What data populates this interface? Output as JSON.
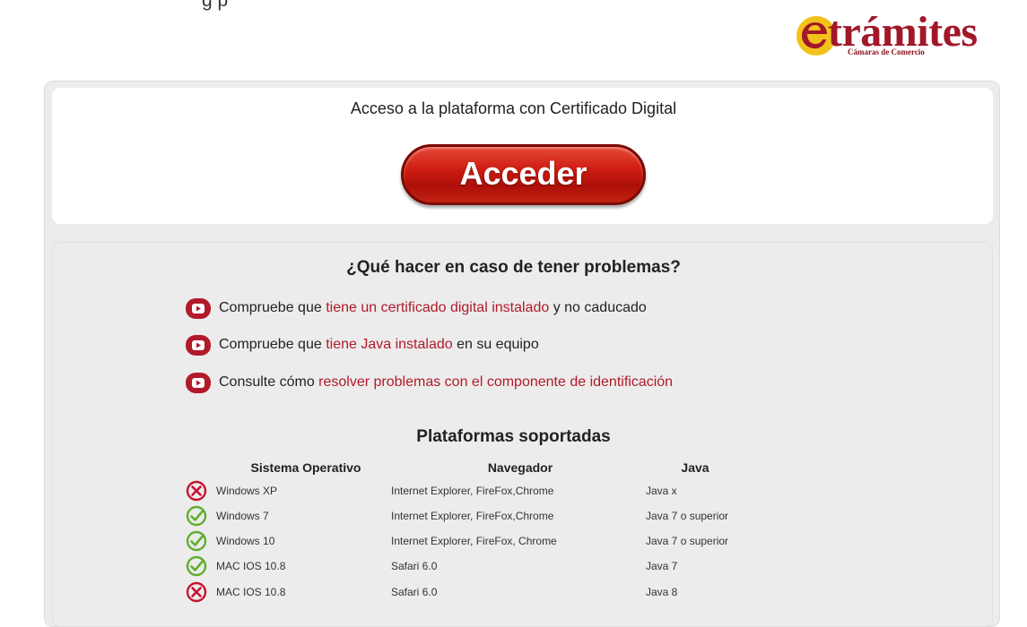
{
  "header": {
    "top_partial_text": "g     p",
    "logo": {
      "brand": "trámites",
      "subtitle": "Cámaras de Comercio",
      "icon": "etramites-e-icon"
    }
  },
  "access": {
    "title": "Acceso a la plataforma con Certificado Digital",
    "button_label": "Acceder"
  },
  "help": {
    "title": "¿Qué hacer en caso de tener problemas?",
    "items": [
      {
        "icon": "play-icon",
        "prefix": "Compruebe que ",
        "link": "tiene un certificado digital instalado",
        "suffix": " y no caducado"
      },
      {
        "icon": "play-icon",
        "prefix": "Compruebe que ",
        "link": "tiene Java instalado",
        "suffix": " en su equipo"
      },
      {
        "icon": "play-icon",
        "prefix": "Consulte cómo ",
        "link": "resolver problemas con el componente de identificación",
        "suffix": ""
      }
    ]
  },
  "platforms": {
    "title": "Plataformas soportadas",
    "headers": {
      "os": "Sistema Operativo",
      "browser": "Navegador",
      "java": "Java"
    },
    "rows": [
      {
        "supported": false,
        "os": "Windows XP",
        "browser": "Internet Explorer, FireFox,Chrome",
        "java": "Java x"
      },
      {
        "supported": true,
        "os": "Windows 7",
        "browser": "Internet Explorer, FireFox,Chrome",
        "java": "Java 7 o superior"
      },
      {
        "supported": true,
        "os": "Windows 10",
        "browser": "Internet Explorer, FireFox, Chrome",
        "java": "Java 7 o superior"
      },
      {
        "supported": true,
        "os": "MAC IOS 10.8",
        "browser": "Safari 6.0",
        "java": "Java 7"
      },
      {
        "supported": false,
        "os": "MAC IOS 10.8",
        "browser": "Safari 6.0",
        "java": "Java 8"
      }
    ]
  },
  "colors": {
    "brand_red": "#a1182a",
    "link_red": "#b21a2a",
    "ok_green": "#5fae2e",
    "fail_red": "#c8102e",
    "panel_gray": "#ececec"
  }
}
